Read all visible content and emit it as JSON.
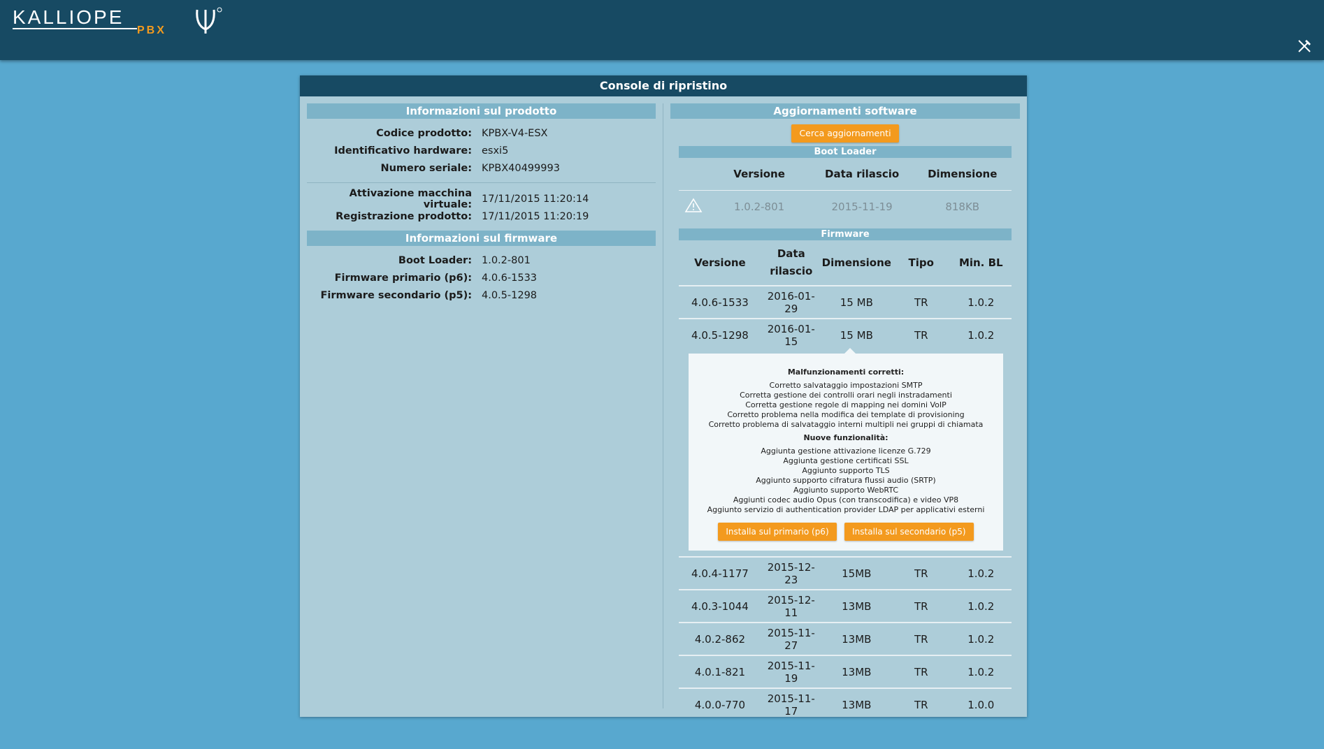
{
  "header": {
    "logo_text": "KALLIOPE",
    "logo_sub": "PBX",
    "tools_icon": "tools-icon"
  },
  "console": {
    "title": "Console di ripristino",
    "product": {
      "title": "Informazioni sul prodotto",
      "rows": [
        {
          "label": "Codice prodotto:",
          "value": "KPBX-V4-ESX"
        },
        {
          "label": "Identificativo hardware:",
          "value": "esxi5"
        },
        {
          "label": "Numero seriale:",
          "value": "KPBX40499993"
        }
      ],
      "rows2": [
        {
          "label": "Attivazione macchina virtuale:",
          "value": "17/11/2015 11:20:14"
        },
        {
          "label": "Registrazione prodotto:",
          "value": "17/11/2015 11:20:19"
        }
      ]
    },
    "firmware_info": {
      "title": "Informazioni sul firmware",
      "rows": [
        {
          "label": "Boot Loader:",
          "value": "1.0.2-801"
        },
        {
          "label": "Firmware primario (p6):",
          "value": "4.0.6-1533"
        },
        {
          "label": "Firmware secondario (p5):",
          "value": "4.0.5-1298"
        }
      ]
    },
    "updates": {
      "title": "Aggiornamenti software",
      "check_button": "Cerca aggiornamenti",
      "bootloader": {
        "title": "Boot Loader",
        "headers": [
          "Versione",
          "Data rilascio",
          "Dimensione"
        ],
        "warning_icon": "warning-icon",
        "row": {
          "version": "1.0.2-801",
          "date": "2015-11-19",
          "size": "818KB"
        }
      },
      "firmware": {
        "title": "Firmware",
        "headers": {
          "version": "Versione",
          "date_1": "Data",
          "date_2": "rilascio",
          "size": "Dimensione",
          "type": "Tipo",
          "min_bl": "Min. BL"
        },
        "rows": [
          {
            "version": "4.0.6-1533",
            "date": "2016-01-29",
            "size": "15 MB",
            "type": "TR",
            "min_bl": "1.0.2"
          },
          {
            "version": "4.0.5-1298",
            "date": "2016-01-15",
            "size": "15 MB",
            "type": "TR",
            "min_bl": "1.0.2"
          },
          {
            "version": "4.0.4-1177",
            "date": "2015-12-23",
            "size": "15MB",
            "type": "TR",
            "min_bl": "1.0.2"
          },
          {
            "version": "4.0.3-1044",
            "date": "2015-12-11",
            "size": "13MB",
            "type": "TR",
            "min_bl": "1.0.2"
          },
          {
            "version": "4.0.2-862",
            "date": "2015-11-27",
            "size": "13MB",
            "type": "TR",
            "min_bl": "1.0.2"
          },
          {
            "version": "4.0.1-821",
            "date": "2015-11-19",
            "size": "13MB",
            "type": "TR",
            "min_bl": "1.0.2"
          },
          {
            "version": "4.0.0-770",
            "date": "2015-11-17",
            "size": "13MB",
            "type": "TR",
            "min_bl": "1.0.0"
          }
        ],
        "details": {
          "fixes_title": "Malfunzionamenti corretti",
          "fixes": [
            "Corretto salvataggio impostazioni SMTP",
            "Corretta gestione dei controlli orari negli instradamenti",
            "Corretta gestione regole di mapping nei domini VoIP",
            "Corretto problema nella modifica dei template di provisioning",
            "Corretto problema di salvataggio interni multipli nei gruppi di chiamata"
          ],
          "features_title": "Nuove funzionalità",
          "features": [
            "Aggiunta gestione attivazione licenze G.729",
            "Aggiunta gestione certificati SSL",
            "Aggiunto supporto TLS",
            "Aggiunto supporto cifratura flussi audio (SRTP)",
            "Aggiunto supporto WebRTC",
            "Aggiunti codec audio Opus (con transcodifica) e video VP8",
            "Aggiunto servizio di authentication provider LDAP per applicativi esterni"
          ],
          "install_primary": "Installa sul primario (p6)",
          "install_secondary": "Installa sul secondario (p5)"
        }
      }
    }
  },
  "colors": {
    "background": "#58a8cf",
    "header": "#174a63",
    "panel": "#adcdd9",
    "section_header": "#7db3c8",
    "button": "#f39a1e"
  }
}
